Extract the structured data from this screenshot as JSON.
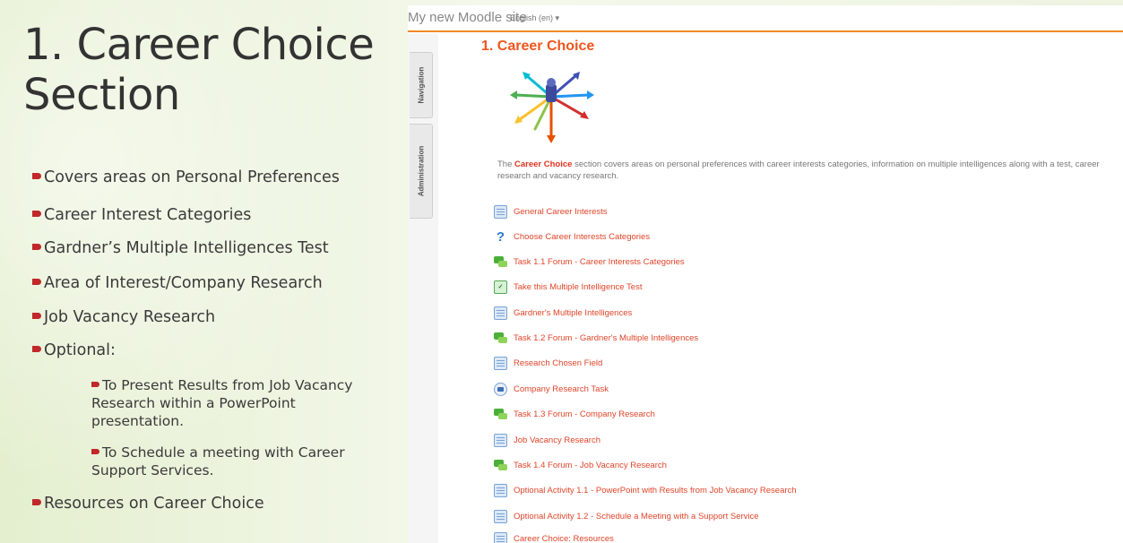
{
  "slide": {
    "title": "1. Career Choice Section",
    "bullets": [
      "Covers areas on Personal Preferences",
      "Career Interest Categories",
      "Gardner’s Multiple Intelligences Test",
      "Area of Interest/Company Research",
      "Job Vacancy Research",
      "Optional:"
    ],
    "sub_bullets": [
      "To Present Results from Job Vacancy Research within a PowerPoint presentation.",
      "To Schedule a meeting with Career Support Services."
    ],
    "last_bullet": "Resources on Career Choice"
  },
  "moodle": {
    "site_name": "My new Moodle site",
    "language": "English (en) ▾",
    "side_tabs": [
      "Navigation",
      "Administration"
    ],
    "section_title": "1. Career Choice",
    "summary_prefix": "The ",
    "summary_bold": "Career Choice",
    "summary_rest": " section covers areas on personal preferences with career interests categories, information on multiple intelligences along with a test, career research and vacancy research.",
    "activities": [
      {
        "icon": "page-icon",
        "label": "General Career Interests"
      },
      {
        "icon": "quiz-icon",
        "label": "Choose Career Interests Categories"
      },
      {
        "icon": "forum-icon",
        "label": "Task 1.1 Forum - Career Interests Categories"
      },
      {
        "icon": "test-icon",
        "label": "Take this Multiple Intelligence Test"
      },
      {
        "icon": "page-icon",
        "label": "Gardner's Multiple Intelligences"
      },
      {
        "icon": "forum-icon",
        "label": "Task 1.2 Forum - Gardner's Multiple Intelligences"
      },
      {
        "icon": "page-icon",
        "label": "Research Chosen Field"
      },
      {
        "icon": "url-icon",
        "label": "Company Research Task"
      },
      {
        "icon": "forum-icon",
        "label": "Task 1.3 Forum - Company Research"
      },
      {
        "icon": "page-icon",
        "label": "Job Vacancy Research"
      },
      {
        "icon": "forum-icon",
        "label": "Task 1.4 Forum - Job Vacancy Research"
      },
      {
        "icon": "page-icon",
        "label": "Optional Activity 1.1 - PowerPoint with Results from Job Vacancy Research"
      },
      {
        "icon": "page-icon",
        "label": "Optional Activity 1.2 - Schedule a Meeting with a Support Service"
      },
      {
        "icon": "page-icon",
        "label": "Career Choice: Resources"
      }
    ]
  },
  "colors": {
    "accent_orange": "#f08a24",
    "link_red": "#e0452a",
    "bullet_red": "#c0282a"
  }
}
